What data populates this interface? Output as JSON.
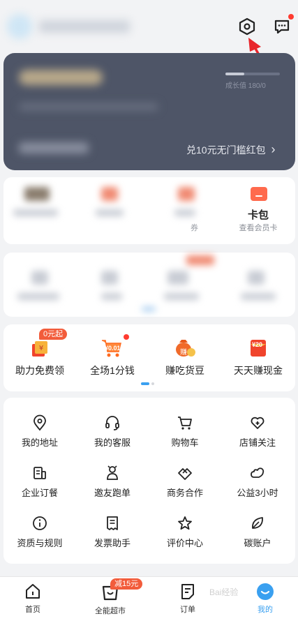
{
  "header": {
    "avatar_icon": "avatar-icon",
    "settings_icon": "settings-hex-icon",
    "message_icon": "message-bubble-icon"
  },
  "member_card": {
    "growth_text": "成长值 180/0",
    "growth_progress": 0.35,
    "redpack_text": "兑10元无门槛红包",
    "redpack_arrow": "›"
  },
  "assets": {
    "kabao_title": "卡包",
    "kabao_sub": "查看会员卡",
    "partial_text": "券"
  },
  "promotions": [
    {
      "label": "助力免费领",
      "badge": "0元起",
      "icon": "red-envelope-yuan-icon"
    },
    {
      "label": "全场1分钱",
      "badge": "",
      "icon": "shopping-cart-0.01-icon",
      "coin": "¥0.01"
    },
    {
      "label": "赚吃货豆",
      "badge": "",
      "icon": "coin-bag-icon",
      "coin": "赚"
    },
    {
      "label": "天天赚现金",
      "badge": "",
      "icon": "red-envelope-20-icon",
      "coin": "¥20"
    }
  ],
  "services": [
    {
      "label": "我的地址",
      "icon": "location-pin-icon"
    },
    {
      "label": "我的客服",
      "icon": "headset-icon"
    },
    {
      "label": "购物车",
      "icon": "cart-icon"
    },
    {
      "label": "店铺关注",
      "icon": "heart-plus-icon"
    },
    {
      "label": "企业订餐",
      "icon": "building-icon"
    },
    {
      "label": "邀友跑单",
      "icon": "runner-icon"
    },
    {
      "label": "商务合作",
      "icon": "handshake-icon"
    },
    {
      "label": "公益3小时",
      "icon": "hands-heart-icon"
    },
    {
      "label": "资质与规则",
      "icon": "info-icon"
    },
    {
      "label": "发票助手",
      "icon": "receipt-icon"
    },
    {
      "label": "评价中心",
      "icon": "star-icon"
    },
    {
      "label": "碳账户",
      "icon": "leaf-icon"
    }
  ],
  "tabs": [
    {
      "label": "首页",
      "icon": "home-icon"
    },
    {
      "label": "全能超市",
      "icon": "supermarket-bag-icon",
      "badge": "减15元"
    },
    {
      "label": "订单",
      "icon": "order-list-icon"
    },
    {
      "label": "我的",
      "icon": "profile-smile-icon"
    }
  ],
  "watermark": "Bai经验"
}
